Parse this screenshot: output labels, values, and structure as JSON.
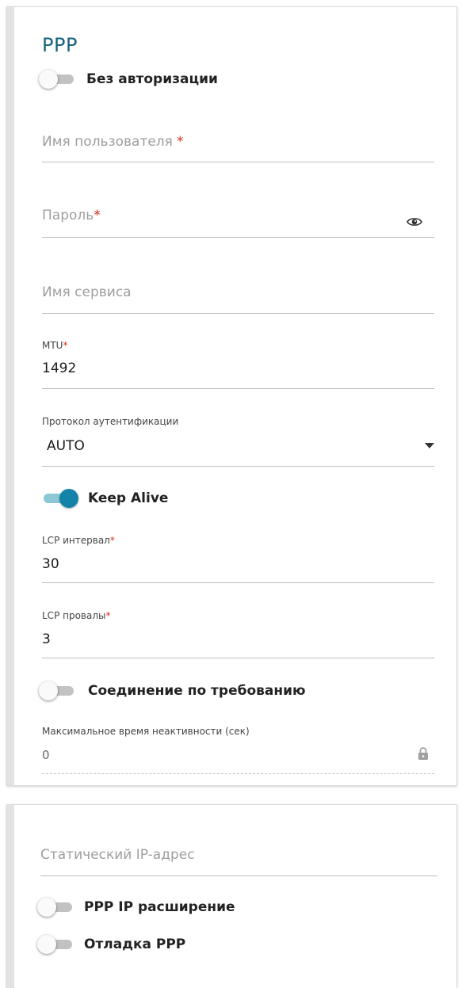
{
  "ppp": {
    "title": "PPP",
    "no_auth_toggle": {
      "label": "Без авторизации",
      "on": false
    },
    "username": {
      "placeholder": "Имя пользователя",
      "required_mark": "*",
      "value": ""
    },
    "password": {
      "placeholder": "Пароль",
      "required_mark": "*",
      "value": "",
      "icon": "eye-icon"
    },
    "service_name": {
      "placeholder": "Имя сервиса",
      "value": ""
    },
    "mtu": {
      "label": "MTU",
      "required_mark": "*",
      "value": "1492"
    },
    "auth_protocol": {
      "label": "Протокол аутентификации",
      "value": "AUTO",
      "icon": "dropdown-arrow-icon"
    },
    "keep_alive_toggle": {
      "label": "Keep Alive",
      "on": true
    },
    "lcp_interval": {
      "label": "LCP интервал",
      "required_mark": "*",
      "value": "30"
    },
    "lcp_failures": {
      "label": "LCP провалы",
      "required_mark": "*",
      "value": "3"
    },
    "on_demand_toggle": {
      "label": "Соединение по требованию",
      "on": false
    },
    "max_idle": {
      "label": "Максимальное время неактивности (сек)",
      "value": "0",
      "icon": "lock-icon"
    }
  },
  "extra": {
    "static_ip": {
      "placeholder": "Статический IP-адрес",
      "value": ""
    },
    "ppp_ip_ext_toggle": {
      "label": "PPP IP расширение",
      "on": false
    },
    "ppp_debug_toggle": {
      "label": "Отладка PPP",
      "on": false
    }
  },
  "colors": {
    "accent": "#1384a8",
    "title": "#14637a",
    "required": "#d22c1c"
  }
}
